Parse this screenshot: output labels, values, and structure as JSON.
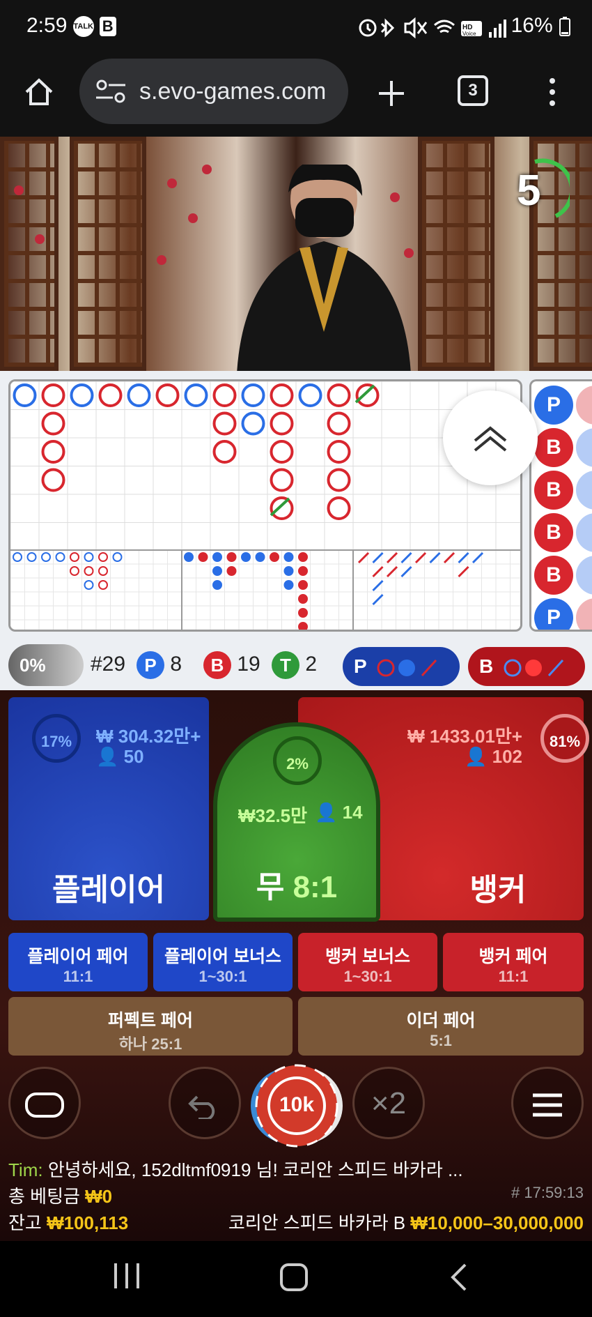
{
  "status_bar": {
    "time": "2:59",
    "talk_icon": "TALK",
    "b_icon": "B",
    "battery": "16%"
  },
  "browser": {
    "url": "s.evo-games.com",
    "tab_count": "3"
  },
  "video": {
    "countdown": "5"
  },
  "stats": {
    "percent": "0%",
    "round": "#29",
    "player_label": "P",
    "player_count": "8",
    "banker_label": "B",
    "banker_count": "19",
    "tie_label": "T",
    "tie_count": "2",
    "predict_player": "P",
    "predict_banker": "B"
  },
  "side_road": [
    "P",
    "B",
    "B",
    "B",
    "B",
    "P"
  ],
  "player": {
    "pct": "17%",
    "amount": "₩ 304.32만+",
    "users": "50",
    "label": "플레이어"
  },
  "tie": {
    "pct": "2%",
    "amount": "₩32.5만",
    "users": "14",
    "label": "무",
    "odds": "8:1"
  },
  "banker": {
    "pct": "81%",
    "amount": "₩ 1433.01만+",
    "users": "102",
    "label": "뱅커"
  },
  "side_bets": [
    {
      "title": "플레이어 페어",
      "odds": "11:1"
    },
    {
      "title": "플레이어 보너스",
      "odds": "1~30:1"
    },
    {
      "title": "뱅커 보너스",
      "odds": "1~30:1"
    },
    {
      "title": "뱅커 페어",
      "odds": "11:1"
    }
  ],
  "wide_bets": [
    {
      "title": "퍼펙트 페어",
      "odds": "하나 25:1"
    },
    {
      "title": "이더 페어",
      "odds": "5:1"
    }
  ],
  "chip": {
    "value": "10k"
  },
  "double": "×2",
  "chat": {
    "name": "Tim:",
    "message": "안녕하세요, 152dltmf0919 님! 코리안 스피드 바카라 ..."
  },
  "total_bet": {
    "label": "총 베팅금",
    "value": "₩0"
  },
  "game_id": "# 17:59:13",
  "balance": {
    "label": "잔고",
    "value": "₩100,113"
  },
  "table": {
    "name": "코리안 스피드 바카라 B",
    "limits": "₩10,000–30,000,000"
  },
  "colors": {
    "player": "#1f47c8",
    "banker": "#c8222a",
    "tie": "#3f9b2a",
    "gold": "#f5c518"
  }
}
